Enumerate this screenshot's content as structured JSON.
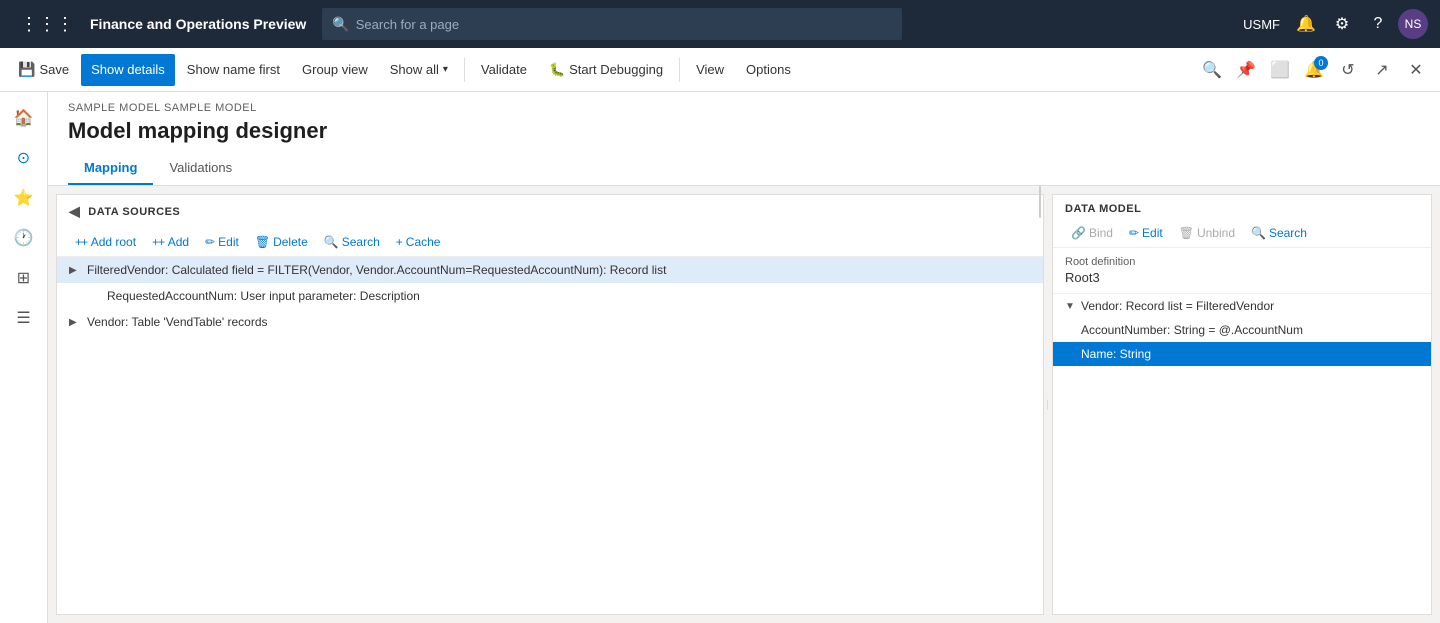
{
  "app": {
    "title": "Finance and Operations Preview"
  },
  "topnav": {
    "search_placeholder": "Search for a page",
    "user": "USMF",
    "avatar_initials": "NS",
    "notification_count": "0"
  },
  "commandbar": {
    "save_label": "Save",
    "show_details_label": "Show details",
    "show_name_first_label": "Show name first",
    "group_view_label": "Group view",
    "show_all_label": "Show all",
    "validate_label": "Validate",
    "start_debugging_label": "Start Debugging",
    "view_label": "View",
    "options_label": "Options"
  },
  "page": {
    "breadcrumb": "SAMPLE MODEL SAMPLE MODEL",
    "title": "Model mapping designer"
  },
  "tabs": [
    {
      "label": "Mapping",
      "active": true
    },
    {
      "label": "Validations",
      "active": false
    }
  ],
  "data_sources": {
    "panel_title": "DATA SOURCES",
    "toolbar": {
      "add_root": "+ Add root",
      "add": "+ Add",
      "edit": "Edit",
      "delete": "Delete",
      "search": "Search",
      "cache": "Cache"
    },
    "items": [
      {
        "id": 1,
        "text": "FilteredVendor: Calculated field = FILTER(Vendor, Vendor.AccountNum=RequestedAccountNum): Record list",
        "level": 0,
        "expandable": true,
        "selected": true
      },
      {
        "id": 2,
        "text": "RequestedAccountNum: User input parameter: Description",
        "level": 1,
        "expandable": false,
        "selected": false
      },
      {
        "id": 3,
        "text": "Vendor: Table 'VendTable' records",
        "level": 0,
        "expandable": true,
        "selected": false
      }
    ]
  },
  "data_model": {
    "panel_title": "DATA MODEL",
    "toolbar": {
      "bind": "Bind",
      "edit": "Edit",
      "unbind": "Unbind",
      "search": "Search"
    },
    "root_definition_label": "Root definition",
    "root_definition_value": "Root3",
    "items": [
      {
        "id": 1,
        "text": "Vendor: Record list = FilteredVendor",
        "level": 0,
        "expandable": true,
        "expanded": true,
        "selected": false
      },
      {
        "id": 2,
        "text": "AccountNumber: String = @.AccountNum",
        "level": 1,
        "expandable": false,
        "selected": false
      },
      {
        "id": 3,
        "text": "Name: String",
        "level": 1,
        "expandable": false,
        "selected": true
      }
    ]
  }
}
